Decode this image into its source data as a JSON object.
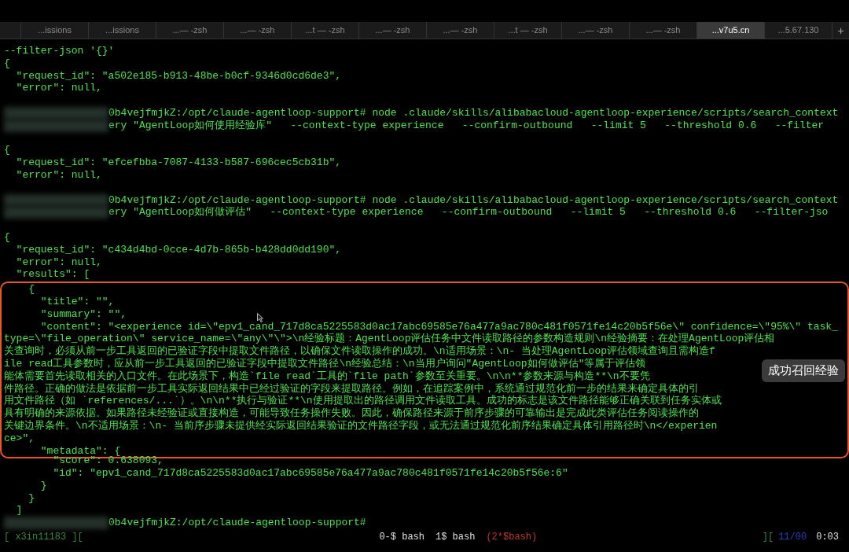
{
  "tabs": [
    {
      "label": "...issions",
      "selected": false
    },
    {
      "label": "...issions",
      "selected": false
    },
    {
      "label": "...— -zsh",
      "selected": false
    },
    {
      "label": "...— -zsh",
      "selected": false
    },
    {
      "label": "...t — -zsh",
      "selected": false
    },
    {
      "label": "...— -zsh",
      "selected": false
    },
    {
      "label": "...— -zsh",
      "selected": false
    },
    {
      "label": "...t — -zsh",
      "selected": false
    },
    {
      "label": "...— -zsh",
      "selected": false
    },
    {
      "label": "...— -zsh",
      "selected": false
    },
    {
      "label": "...v7u5.cn",
      "selected": true
    },
    {
      "label": "...5.67.130",
      "selected": false
    }
  ],
  "new_tab": "+",
  "terminal": {
    "lines_before": [
      {
        "kind": "text",
        "text": "--filter-json '{}'"
      },
      {
        "kind": "text",
        "text": "{"
      },
      {
        "kind": "text",
        "text": "  \"request_id\": \"a502e185-b913-48be-b0cf-9346d0cd6de3\","
      },
      {
        "kind": "text",
        "text": "  \"error\": null,"
      },
      {
        "kind": "blank"
      },
      {
        "kind": "blurred",
        "text": "0b4vejfmjkZ:/opt/claude-agentloop-support# node .claude/skills/alibabacloud-agentloop-experience/scripts/search_context"
      },
      {
        "kind": "blurred",
        "text": "ery \"AgentLoop如何使用经验库\"   --context-type experience   --confirm-outbound   --limit 5   --threshold 0.6   --filter"
      },
      {
        "kind": "blank"
      },
      {
        "kind": "text",
        "text": "{"
      },
      {
        "kind": "text",
        "text": "  \"request_id\": \"efcefbba-7087-4133-b587-696cec5cb31b\","
      },
      {
        "kind": "text",
        "text": "  \"error\": null,"
      },
      {
        "kind": "blank"
      },
      {
        "kind": "blurred",
        "text": "0b4vejfmjkZ:/opt/claude-agentloop-support# node .claude/skills/alibabacloud-agentloop-experience/scripts/search_context"
      },
      {
        "kind": "blurred",
        "text": "ery \"AgentLoop如何做评估\"   --context-type experience   --confirm-outbound   --limit 5   --threshold 0.6   --filter-jso"
      },
      {
        "kind": "blank"
      },
      {
        "kind": "text",
        "text": "{"
      },
      {
        "kind": "text",
        "text": "  \"request_id\": \"c434d4bd-0cce-4d7b-865b-b428dd0dd190\","
      },
      {
        "kind": "text",
        "text": "  \"error\": null,"
      },
      {
        "kind": "text",
        "text": "  \"results\": ["
      }
    ],
    "highlighted_lines": [
      {
        "kind": "text",
        "text": "    {"
      },
      {
        "kind": "text",
        "text": "      \"title\": \"\","
      },
      {
        "kind": "text",
        "text": "      \"summary\": \"\","
      },
      {
        "kind": "text",
        "text": "      \"content\": \"<experience id=\\\"epv1_cand_717d8ca5225583d0ac17abc69585e76a477a9ac780c481f0571fe14c20b5f56e\\\" confidence=\\\"95%\\\" task_"
      },
      {
        "kind": "text",
        "text": "type=\\\"file_operation\\\" service_name=\\\"any\\\"\\\">\\n经验标题：AgentLoop评估任务中文件读取路径的参数构造规则\\n经验摘要：在处理AgentLoop评估相"
      },
      {
        "kind": "text",
        "text": "关查询时，必须从前一步工具返回的已验证字段中提取文件路径，以确保文件读取操作的成功。\\n适用场景：\\n- 当处理AgentLoop评估领域查询且需构造f"
      },
      {
        "kind": "text",
        "text": "ile read工具参数时，应从前一步工具返回的已验证字段中提取文件路径\\n经验总结：\\n当用户询问\"AgentLoop如何做评估\"等属于评估领"
      },
      {
        "kind": "text",
        "text": "能体需要首先读取相关的入口文件。在此场景下，构造`file read`工具的`file path`参数至关重要。\\n\\n**参数来源与构造**\\n不要凭"
      },
      {
        "kind": "text",
        "text": "件路径。正确的做法是依据前一步工具实际返回结果中已经过验证的字段来提取路径。例如，在追踪案例中，系统通过规范化前一步的结果来确定具体的引"
      },
      {
        "kind": "text",
        "text": "用文件路径（如 `references/...`）。\\n\\n**执行与验证**\\n使用提取出的路径调用文件读取工具。成功的标志是该文件路径能够正确关联到任务实体或"
      },
      {
        "kind": "text",
        "text": "具有明确的来源依据。如果路径未经验证或直接构造，可能导致任务操作失败。因此，确保路径来源于前序步骤的可靠输出是完成此类评估任务阅读操作的"
      },
      {
        "kind": "text",
        "text": "关键边界条件。\\n不适用场景：\\n- 当前序步骤未提供经实际返回结果验证的文件路径字段，或无法通过规范化前序结果确定具体引用路径时\\n</experien"
      },
      {
        "kind": "text",
        "text": "ce>\","
      },
      {
        "kind": "text",
        "text": "      \"metadata\": {"
      }
    ],
    "lines_after": [
      {
        "kind": "text",
        "text": "        \"score\": 0.638093,"
      },
      {
        "kind": "text",
        "text": "        \"id\": \"epv1_cand_717d8ca5225583d0ac17abc69585e76a477a9ac780c481f0571fe14c20b5f56e:6\""
      },
      {
        "kind": "text",
        "text": "      }"
      },
      {
        "kind": "text",
        "text": "    }"
      },
      {
        "kind": "text",
        "text": "  ]"
      },
      {
        "kind": "blurred",
        "text": "0b4vejfmjkZ:/opt/claude-agentloop-support#"
      }
    ]
  },
  "callout": {
    "text": "成功召回经验"
  },
  "status_bar": {
    "left": "[ x3in11183 ][",
    "windows": [
      {
        "label": "0-$ bash",
        "selected": false
      },
      {
        "label": "1$ bash",
        "selected": false
      },
      {
        "label": "(2*$bash)",
        "selected": true
      }
    ],
    "right_open": "][",
    "counter": "11/00",
    "time": "0:03"
  }
}
